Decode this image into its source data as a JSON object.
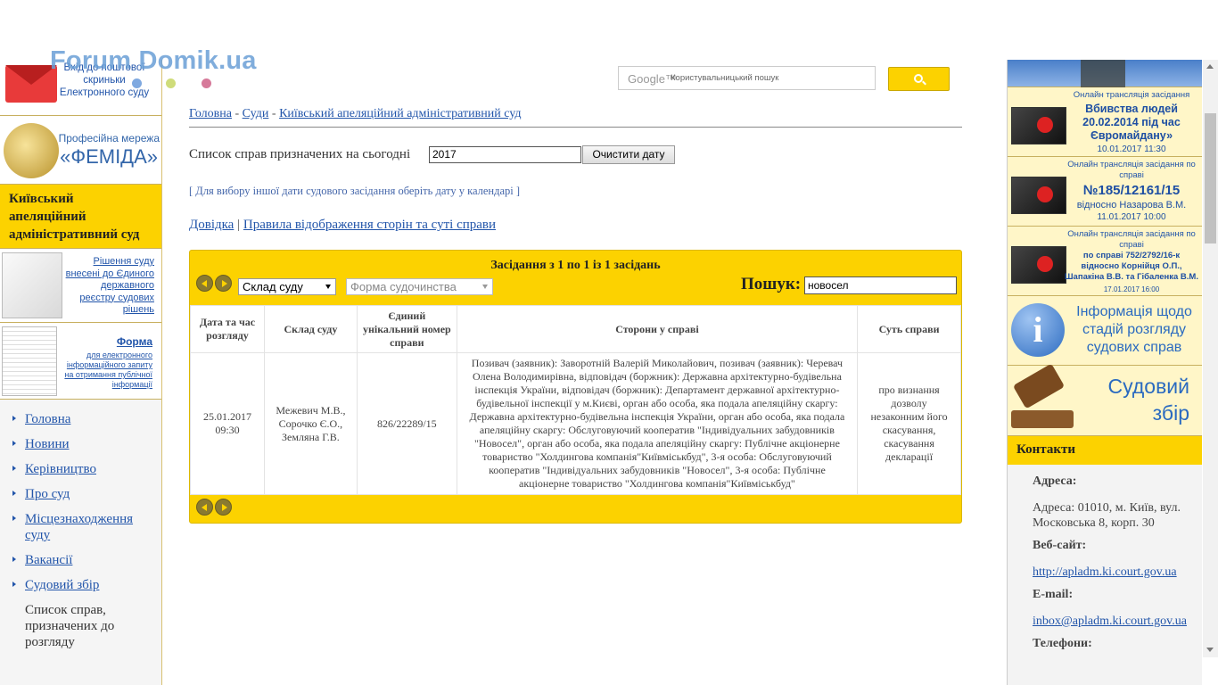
{
  "watermark": "Forum Domik.ua",
  "left": {
    "mail_link": "Вхід до поштової скриньки Електронного суду",
    "femida_line1": "Професійна мережа",
    "femida_line2": "«ФЕМІДА»",
    "court_name": "Київський апеляційний адміністративний суд",
    "reestr_link": "Рішення суду внесені до Єдиного державного реєстру судових рішень",
    "forma_title": "Форма",
    "forma_desc": "для електронного інформаційного запиту на отримання публічної інформації",
    "nav": [
      {
        "label": "Головна"
      },
      {
        "label": "Новини"
      },
      {
        "label": "Керівництво"
      },
      {
        "label": "Про суд"
      },
      {
        "label": "Місцезнаходження суду"
      },
      {
        "label": "Вакансії"
      },
      {
        "label": "Судовий збір"
      }
    ],
    "current_item": "Список справ, призначених до розгляду"
  },
  "search": {
    "logo": "Google™",
    "placeholder": "Користувальницький пошук"
  },
  "breadcrumb": {
    "home": "Головна",
    "courts": "Суди",
    "court": "Київський апеляційний адміністративний суд",
    "sep": "-"
  },
  "schedule": {
    "label": "Список справ призначених на сьогодні",
    "date_value": "2017",
    "clear_label": "Очистити дату",
    "hint": "[ Для вибору іншої дати судового засідання оберіть дату у календарі ]",
    "help_link": "Довідка",
    "rules_link": "Правила відображення сторін та суті справи",
    "link_sep": "|"
  },
  "panel": {
    "header": "Засідання з 1 по 1 із 1 засідань",
    "court_select": "Склад суду",
    "form_select": "Форма судочинства",
    "search_label": "Пошук:",
    "search_value": "новосел",
    "columns": [
      "Дата та час розгляду",
      "Склад суду",
      "Єдиний унікальний номер справи",
      "Сторони у справі",
      "Суть справи"
    ],
    "rows": [
      {
        "datetime": "25.01.2017 09:30",
        "judges": "Межевич М.В., Сорочко Є.О., Земляна Г.В.",
        "case_number": "826/22289/15",
        "parties": "Позивач (заявник): Заворотній Валерій Миколайович, позивач (заявник): Черевач Олена Володимирівна, відповідач (боржник): Державна архітектурно-будівельна інспекція України, відповідач (боржник): Департамент державної архітектурно-будівельної інспекції у м.Києві, орган або особа, яка подала апеляційну скаргу: Державна архітектурно-будівельна інспекція України, орган або особа, яка подала апеляційну скаргу: Обслуговуючий кооператив \"Індивідуальних забудовників \"Новосел\", орган або особа, яка подала апеляційну скаргу: Публічне акціонерне товариство \"Холдингова компанія\"Київміськбуд\", 3-я особа: Обслуговуючий кооператив \"Індивідуальних забудовників \"Новосел\", 3-я особа: Публічне акціонерне товариство \"Холдингова компанія\"Київміськбуд\"",
        "essence": "про визнання дозволу незаконним його скасування, скасування декларації"
      }
    ]
  },
  "right": {
    "stream1": {
      "header": "Онлайн трансляція засідання",
      "title": "Вбивства людей 20.02.2014 під час Євромайдану»",
      "date": "10.01.2017 11:30"
    },
    "stream2": {
      "header": "Онлайн трансляція засідання по справі",
      "title": "№185/12161/15",
      "sub": "відносно Назарова В.М.",
      "date": "11.01.2017 10:00"
    },
    "stream3": {
      "header": "Онлайн трансляція засідання по справі",
      "title": "по справі 752/2792/16-к відносно Корнійця О.П., Шапакіна В.В. та Гібаленка В.М.",
      "date": "17.01.2017 16:00"
    },
    "info": "Інформація щодо стадій розгляду судових справ",
    "fee": "Судовий збір",
    "contacts_title": "Контакти",
    "address_label": "Адреса:",
    "address": "Адреса: 01010, м. Київ, вул. Московська 8, корп. 30",
    "site_label": "Веб-сайт:",
    "site": "http://apladm.ki.court.gov.ua",
    "email_label": "E-mail:",
    "email": "inbox@apladm.ki.court.gov.ua",
    "phones_label": "Телефони:"
  },
  "colors": {
    "accent_yellow": "#fcd200",
    "link_blue": "#2255aa",
    "watermark_blue": "#6a9fd6",
    "dot_green": "#cfdc7a",
    "dot_pink": "#d67a9a"
  }
}
